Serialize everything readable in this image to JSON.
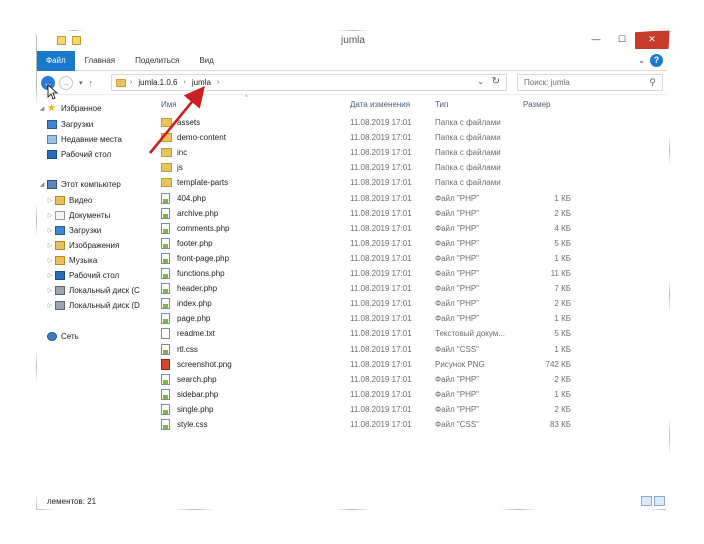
{
  "window": {
    "title": "jumla"
  },
  "ribbon": {
    "tabs": [
      "Файл",
      "Главная",
      "Поделиться",
      "Вид"
    ]
  },
  "nav": {
    "breadcrumbs": [
      "jumla.1.0.6",
      "jumla"
    ],
    "search_placeholder": "Поиск: jumla"
  },
  "sidebar": {
    "favorites_label": "Избранное",
    "favorites": [
      "Загрузки",
      "Недавние места",
      "Рабочий стол"
    ],
    "computer_label": "Этот компьютер",
    "computer": [
      "Видео",
      "Документы",
      "Загрузки",
      "Изображения",
      "Музыка",
      "Рабочий стол",
      "Локальный диск (C",
      "Локальный диск (D"
    ],
    "network_label": "Сеть"
  },
  "columns": {
    "name": "Имя",
    "date": "Дата изменения",
    "type": "Тип",
    "size": "Размер"
  },
  "files": [
    {
      "name": "assets",
      "date": "11.08.2019 17:01",
      "type": "Папка с файлами",
      "size": "",
      "icon": "folder"
    },
    {
      "name": "demo-content",
      "date": "11.08.2019 17:01",
      "type": "Папка с файлами",
      "size": "",
      "icon": "folder"
    },
    {
      "name": "inc",
      "date": "11.08.2019 17:01",
      "type": "Папка с файлами",
      "size": "",
      "icon": "folder"
    },
    {
      "name": "js",
      "date": "11.08.2019 17:01",
      "type": "Папка с файлами",
      "size": "",
      "icon": "folder"
    },
    {
      "name": "template-parts",
      "date": "11.08.2019 17:01",
      "type": "Папка с файлами",
      "size": "",
      "icon": "folder"
    },
    {
      "name": "404.php",
      "date": "11.08.2019 17:01",
      "type": "Файл \"PHP\"",
      "size": "1 КБ",
      "icon": "php"
    },
    {
      "name": "archive.php",
      "date": "11.08.2019 17:01",
      "type": "Файл \"PHP\"",
      "size": "2 КБ",
      "icon": "php"
    },
    {
      "name": "comments.php",
      "date": "11.08.2019 17:01",
      "type": "Файл \"PHP\"",
      "size": "4 КБ",
      "icon": "php"
    },
    {
      "name": "footer.php",
      "date": "11.08.2019 17:01",
      "type": "Файл \"PHP\"",
      "size": "5 КБ",
      "icon": "php"
    },
    {
      "name": "front-page.php",
      "date": "11.08.2019 17:01",
      "type": "Файл \"PHP\"",
      "size": "1 КБ",
      "icon": "php"
    },
    {
      "name": "functions.php",
      "date": "11.08.2019 17:01",
      "type": "Файл \"PHP\"",
      "size": "11 КБ",
      "icon": "php"
    },
    {
      "name": "header.php",
      "date": "11.08.2019 17:01",
      "type": "Файл \"PHP\"",
      "size": "7 КБ",
      "icon": "php"
    },
    {
      "name": "index.php",
      "date": "11.08.2019 17:01",
      "type": "Файл \"PHP\"",
      "size": "2 КБ",
      "icon": "php"
    },
    {
      "name": "page.php",
      "date": "11.08.2019 17:01",
      "type": "Файл \"PHP\"",
      "size": "1 КБ",
      "icon": "php"
    },
    {
      "name": "readme.txt",
      "date": "11.08.2019 17:01",
      "type": "Текстовый докум...",
      "size": "5 КБ",
      "icon": "txt"
    },
    {
      "name": "rtl.css",
      "date": "11.08.2019 17:01",
      "type": "Файл \"CSS\"",
      "size": "1 КБ",
      "icon": "css"
    },
    {
      "name": "screenshot.png",
      "date": "11.08.2019 17:01",
      "type": "Рисунок PNG",
      "size": "742 КБ",
      "icon": "png"
    },
    {
      "name": "search.php",
      "date": "11.08.2019 17:01",
      "type": "Файл \"PHP\"",
      "size": "2 КБ",
      "icon": "php"
    },
    {
      "name": "sidebar.php",
      "date": "11.08.2019 17:01",
      "type": "Файл \"PHP\"",
      "size": "1 КБ",
      "icon": "php"
    },
    {
      "name": "single.php",
      "date": "11.08.2019 17:01",
      "type": "Файл \"PHP\"",
      "size": "2 КБ",
      "icon": "php"
    },
    {
      "name": "style.css",
      "date": "11.08.2019 17:01",
      "type": "Файл \"CSS\"",
      "size": "83 КБ",
      "icon": "css"
    }
  ],
  "status": {
    "text": "лементов: 21"
  },
  "colors": {
    "accent": "#1979ca",
    "annotation_arrow": "#cc2020"
  }
}
